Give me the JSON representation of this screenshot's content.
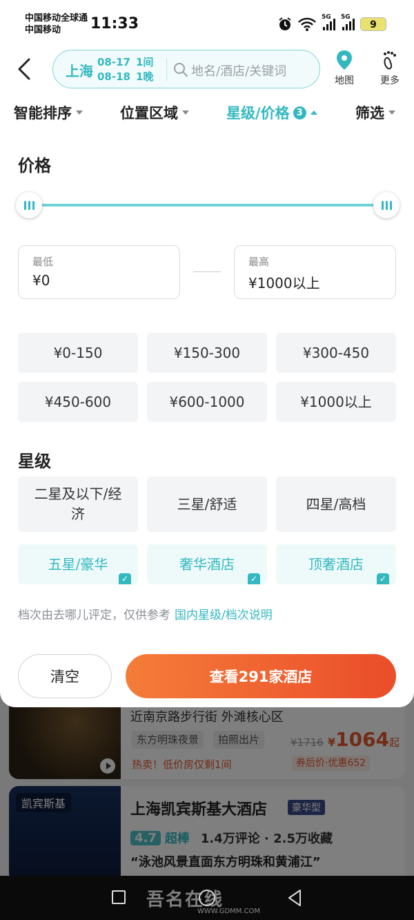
{
  "status_bar": {
    "carrier_line1": "中国移动全球通",
    "carrier_line2": "中国移动",
    "time": "11:33",
    "network1": "5G",
    "network2": "5G",
    "battery": "9"
  },
  "header": {
    "city": "上海",
    "checkin_date": "08-17",
    "rooms": "1间",
    "checkout_date": "08-18",
    "nights": "1晚",
    "search_placeholder": "地名/酒店/关键词",
    "map_label": "地图",
    "more_label": "更多"
  },
  "filter_tabs": [
    {
      "label": "智能排序",
      "active": false
    },
    {
      "label": "位置区域",
      "active": false
    },
    {
      "label": "星级/价格",
      "active": true,
      "count": "3"
    },
    {
      "label": "筛选",
      "active": false
    }
  ],
  "price_section": {
    "title": "价格",
    "slider_min_fraction": 0,
    "slider_max_fraction": 1,
    "min_label": "最低",
    "min_value": "¥0",
    "max_label": "最高",
    "max_value": "¥1000以上",
    "presets": [
      "¥0-150",
      "¥150-300",
      "¥300-450",
      "¥450-600",
      "¥600-1000",
      "¥1000以上"
    ]
  },
  "star_section": {
    "title": "星级",
    "options": [
      {
        "label": "二星及以下/经济",
        "selected": false
      },
      {
        "label": "三星/舒适",
        "selected": false
      },
      {
        "label": "四星/高档",
        "selected": false
      },
      {
        "label": "五星/豪华",
        "selected": true
      },
      {
        "label": "奢华酒店",
        "selected": true
      },
      {
        "label": "顶奢酒店",
        "selected": true
      }
    ]
  },
  "note": {
    "text": "档次由去哪儿评定，仅供参考",
    "link": "国内星级/档次说明"
  },
  "actions": {
    "clear": "清空",
    "view": "查看291家酒店"
  },
  "hotel_card_1": {
    "address": "近南京路步行街 外滩核心区",
    "tags": [
      "东方明珠夜景",
      "拍照出片"
    ],
    "hot_text": "热卖！低价房仅剩1间",
    "price_old": "¥1716",
    "price_currency": "¥",
    "price": "1064",
    "price_suffix": "起",
    "coupon": "券后价·优惠652"
  },
  "hotel_card_2": {
    "brand": "凯宾斯基",
    "name": "上海凯宾斯基大酒店",
    "level": "豪华型",
    "score": "4.7",
    "score_word": "超棒",
    "reviews": "1.4万评论 · 2.5万收藏",
    "slogan": "“泳池风景直面东方明珠和黄浦江”"
  },
  "watermark": {
    "brand": "吾名在线",
    "url": "WWW.GDMM.COM"
  },
  "colors": {
    "accent": "#34b8c0",
    "cta_start": "#f57c39",
    "cta_end": "#ea4d2a",
    "price": "#e4572e"
  }
}
